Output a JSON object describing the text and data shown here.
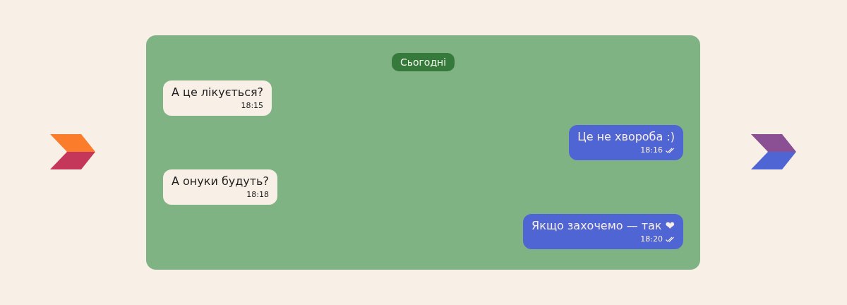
{
  "chat": {
    "date_label": "Сьогодні",
    "messages": [
      {
        "kind": "incoming",
        "text": "А це лікується?",
        "time": "18:15",
        "read": false
      },
      {
        "kind": "outgoing",
        "text": "Це не хвороба :)",
        "time": "18:16",
        "read": true
      },
      {
        "kind": "incoming",
        "text": "А онуки будуть?",
        "time": "18:18",
        "read": false
      },
      {
        "kind": "outgoing",
        "text": "Якщо захочемо — так ❤",
        "time": "18:20",
        "read": true
      }
    ]
  }
}
